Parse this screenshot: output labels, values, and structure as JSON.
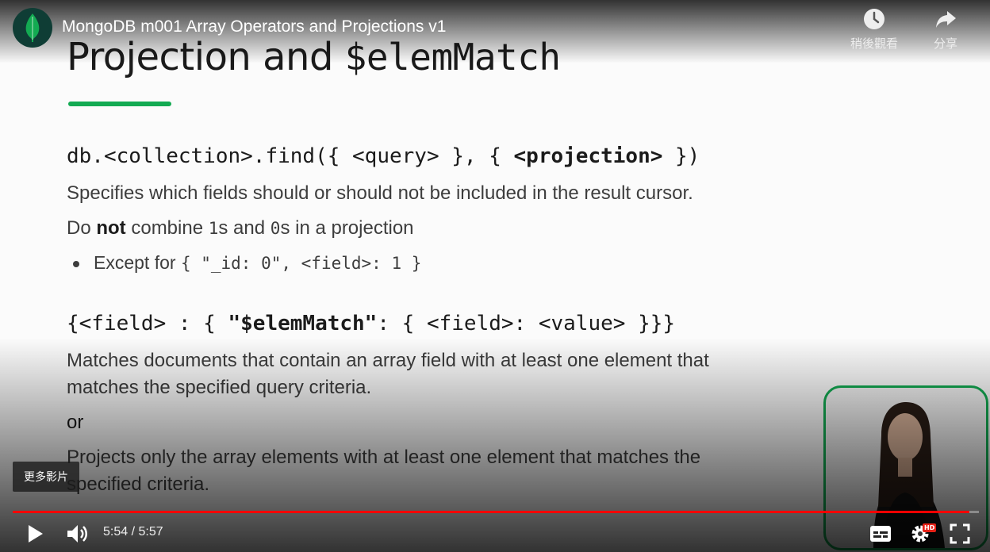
{
  "header": {
    "video_title": "MongoDB m001 Array Operators and Projections v1",
    "watch_later_label": "稍後觀看",
    "share_label": "分享"
  },
  "slide": {
    "title_plain": "Projection and ",
    "title_mono": "$elemMatch",
    "find_prefix": "db.<collection>.find({ <query> }, { ",
    "find_bold": "<projection>",
    "find_suffix": " })",
    "desc1": "Specifies which fields should or should not be included in the result cursor.",
    "desc2_a": "Do ",
    "desc2_b": "not",
    "desc2_c": " combine ",
    "desc2_d": "1",
    "desc2_e": "s and ",
    "desc2_f": "0",
    "desc2_g": "s in a projection",
    "bullet_a": "Except for ",
    "bullet_b": "{ \"_id: 0\", <field>: 1 }",
    "elem_prefix": "{<field> : { ",
    "elem_bold": "\"$elemMatch\"",
    "elem_suffix": ": { <field>: <value> }}}",
    "match_line1": "Matches documents that contain an array field with at least one element that",
    "match_line2": "matches the specified query criteria.",
    "or": "or",
    "proj_line1": "Projects only the array elements with at least one element that matches the",
    "proj_line2": "specified criteria."
  },
  "controls": {
    "more_videos": "更多影片",
    "current_time": "5:54",
    "duration": "5:57",
    "time_display": "5:54 / 5:57",
    "hd_badge": "HD",
    "progress_fraction": 0.99
  },
  "colors": {
    "accent_green": "#13aa52",
    "progress_red": "#ff0000"
  }
}
